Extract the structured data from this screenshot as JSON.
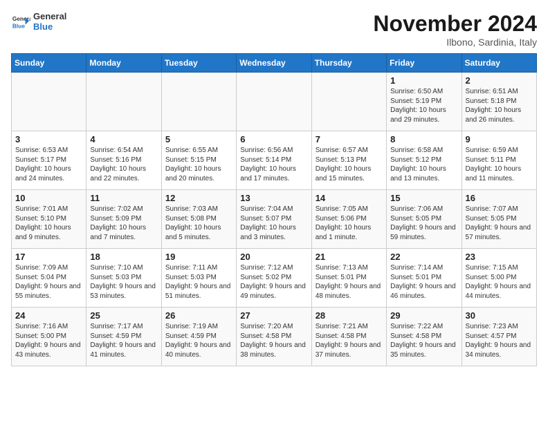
{
  "logo": {
    "line1": "General",
    "line2": "Blue"
  },
  "title": "November 2024",
  "subtitle": "Ilbono, Sardinia, Italy",
  "days_header": [
    "Sunday",
    "Monday",
    "Tuesday",
    "Wednesday",
    "Thursday",
    "Friday",
    "Saturday"
  ],
  "weeks": [
    [
      {
        "num": "",
        "info": ""
      },
      {
        "num": "",
        "info": ""
      },
      {
        "num": "",
        "info": ""
      },
      {
        "num": "",
        "info": ""
      },
      {
        "num": "",
        "info": ""
      },
      {
        "num": "1",
        "info": "Sunrise: 6:50 AM\nSunset: 5:19 PM\nDaylight: 10 hours and 29 minutes."
      },
      {
        "num": "2",
        "info": "Sunrise: 6:51 AM\nSunset: 5:18 PM\nDaylight: 10 hours and 26 minutes."
      }
    ],
    [
      {
        "num": "3",
        "info": "Sunrise: 6:53 AM\nSunset: 5:17 PM\nDaylight: 10 hours and 24 minutes."
      },
      {
        "num": "4",
        "info": "Sunrise: 6:54 AM\nSunset: 5:16 PM\nDaylight: 10 hours and 22 minutes."
      },
      {
        "num": "5",
        "info": "Sunrise: 6:55 AM\nSunset: 5:15 PM\nDaylight: 10 hours and 20 minutes."
      },
      {
        "num": "6",
        "info": "Sunrise: 6:56 AM\nSunset: 5:14 PM\nDaylight: 10 hours and 17 minutes."
      },
      {
        "num": "7",
        "info": "Sunrise: 6:57 AM\nSunset: 5:13 PM\nDaylight: 10 hours and 15 minutes."
      },
      {
        "num": "8",
        "info": "Sunrise: 6:58 AM\nSunset: 5:12 PM\nDaylight: 10 hours and 13 minutes."
      },
      {
        "num": "9",
        "info": "Sunrise: 6:59 AM\nSunset: 5:11 PM\nDaylight: 10 hours and 11 minutes."
      }
    ],
    [
      {
        "num": "10",
        "info": "Sunrise: 7:01 AM\nSunset: 5:10 PM\nDaylight: 10 hours and 9 minutes."
      },
      {
        "num": "11",
        "info": "Sunrise: 7:02 AM\nSunset: 5:09 PM\nDaylight: 10 hours and 7 minutes."
      },
      {
        "num": "12",
        "info": "Sunrise: 7:03 AM\nSunset: 5:08 PM\nDaylight: 10 hours and 5 minutes."
      },
      {
        "num": "13",
        "info": "Sunrise: 7:04 AM\nSunset: 5:07 PM\nDaylight: 10 hours and 3 minutes."
      },
      {
        "num": "14",
        "info": "Sunrise: 7:05 AM\nSunset: 5:06 PM\nDaylight: 10 hours and 1 minute."
      },
      {
        "num": "15",
        "info": "Sunrise: 7:06 AM\nSunset: 5:05 PM\nDaylight: 9 hours and 59 minutes."
      },
      {
        "num": "16",
        "info": "Sunrise: 7:07 AM\nSunset: 5:05 PM\nDaylight: 9 hours and 57 minutes."
      }
    ],
    [
      {
        "num": "17",
        "info": "Sunrise: 7:09 AM\nSunset: 5:04 PM\nDaylight: 9 hours and 55 minutes."
      },
      {
        "num": "18",
        "info": "Sunrise: 7:10 AM\nSunset: 5:03 PM\nDaylight: 9 hours and 53 minutes."
      },
      {
        "num": "19",
        "info": "Sunrise: 7:11 AM\nSunset: 5:03 PM\nDaylight: 9 hours and 51 minutes."
      },
      {
        "num": "20",
        "info": "Sunrise: 7:12 AM\nSunset: 5:02 PM\nDaylight: 9 hours and 49 minutes."
      },
      {
        "num": "21",
        "info": "Sunrise: 7:13 AM\nSunset: 5:01 PM\nDaylight: 9 hours and 48 minutes."
      },
      {
        "num": "22",
        "info": "Sunrise: 7:14 AM\nSunset: 5:01 PM\nDaylight: 9 hours and 46 minutes."
      },
      {
        "num": "23",
        "info": "Sunrise: 7:15 AM\nSunset: 5:00 PM\nDaylight: 9 hours and 44 minutes."
      }
    ],
    [
      {
        "num": "24",
        "info": "Sunrise: 7:16 AM\nSunset: 5:00 PM\nDaylight: 9 hours and 43 minutes."
      },
      {
        "num": "25",
        "info": "Sunrise: 7:17 AM\nSunset: 4:59 PM\nDaylight: 9 hours and 41 minutes."
      },
      {
        "num": "26",
        "info": "Sunrise: 7:19 AM\nSunset: 4:59 PM\nDaylight: 9 hours and 40 minutes."
      },
      {
        "num": "27",
        "info": "Sunrise: 7:20 AM\nSunset: 4:58 PM\nDaylight: 9 hours and 38 minutes."
      },
      {
        "num": "28",
        "info": "Sunrise: 7:21 AM\nSunset: 4:58 PM\nDaylight: 9 hours and 37 minutes."
      },
      {
        "num": "29",
        "info": "Sunrise: 7:22 AM\nSunset: 4:58 PM\nDaylight: 9 hours and 35 minutes."
      },
      {
        "num": "30",
        "info": "Sunrise: 7:23 AM\nSunset: 4:57 PM\nDaylight: 9 hours and 34 minutes."
      }
    ]
  ]
}
